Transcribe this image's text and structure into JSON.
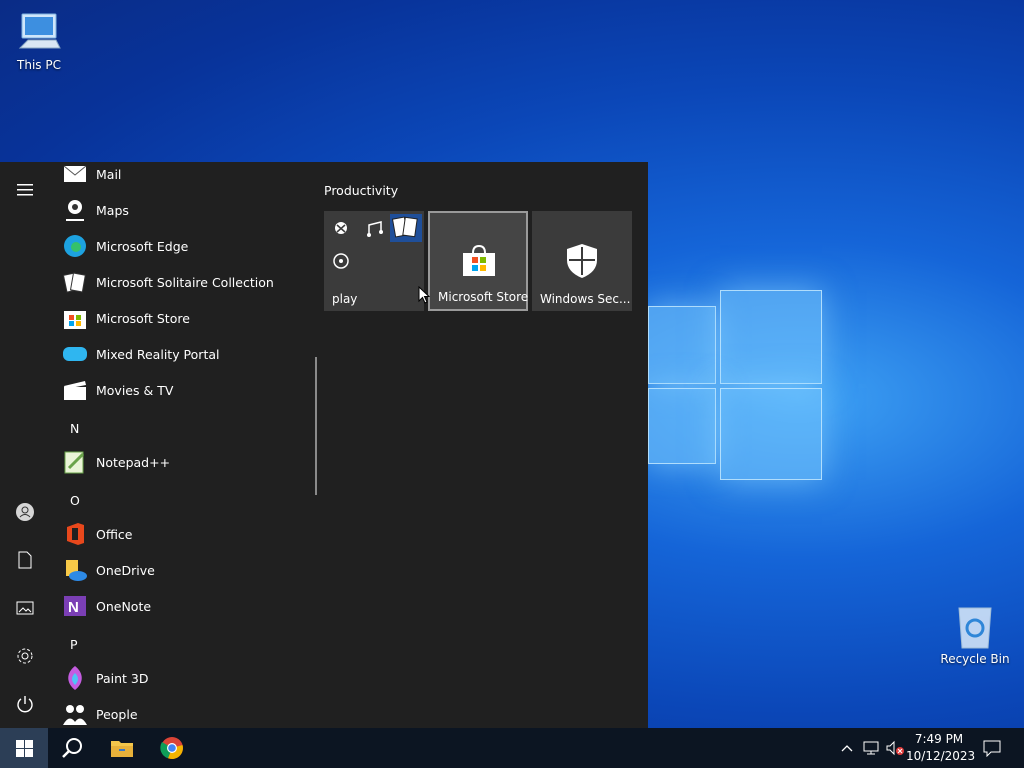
{
  "desktop": {
    "this_pc": "This PC",
    "recycle_bin": "Recycle Bin"
  },
  "start_menu": {
    "apps": [
      {
        "label": "Mail",
        "icon": "mail-icon"
      },
      {
        "label": "Maps",
        "icon": "maps-icon"
      },
      {
        "label": "Microsoft Edge",
        "icon": "edge-icon"
      },
      {
        "label": "Microsoft Solitaire Collection",
        "icon": "solitaire-icon"
      },
      {
        "label": "Microsoft Store",
        "icon": "store-icon"
      },
      {
        "label": "Mixed Reality Portal",
        "icon": "mixed-reality-icon"
      },
      {
        "label": "Movies & TV",
        "icon": "movies-icon"
      },
      {
        "label": "Notepad++",
        "icon": "notepadpp-icon"
      },
      {
        "label": "Office",
        "icon": "office-icon"
      },
      {
        "label": "OneDrive",
        "icon": "onedrive-icon"
      },
      {
        "label": "OneNote",
        "icon": "onenote-icon"
      },
      {
        "label": "Paint 3D",
        "icon": "paint3d-icon"
      },
      {
        "label": "People",
        "icon": "people-icon"
      }
    ],
    "letters": [
      "N",
      "O",
      "P"
    ],
    "group_title": "Productivity",
    "tiles": {
      "play": "play",
      "store": "Microsoft Store",
      "security": "Windows Sec..."
    }
  },
  "taskbar": {
    "time": "7:49 PM",
    "date": "10/12/2023"
  },
  "colors": {
    "start_bg": "#202020",
    "tile_bg": "#3b3b3b",
    "taskbar_bg": "#0c1522"
  }
}
